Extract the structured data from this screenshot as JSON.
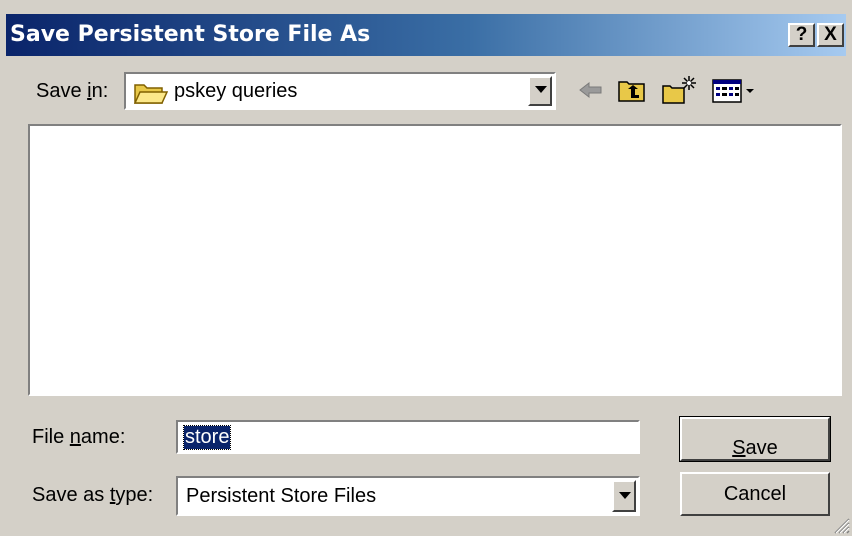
{
  "dialog": {
    "title": "Save Persistent Store File As",
    "help_label": "?",
    "close_label": "X"
  },
  "save_in": {
    "label_pre": "Save ",
    "label_key": "i",
    "label_post": "n:",
    "folder": "pskey queries",
    "folder_icon": "folder-icon"
  },
  "toolbar": {
    "icons": [
      "back-arrow-icon",
      "up-folder-icon",
      "new-folder-icon",
      "view-menu-icon"
    ]
  },
  "file_name": {
    "label_pre": "File ",
    "label_key": "n",
    "label_post": "ame:",
    "value": "store"
  },
  "save_type": {
    "label_pre": "Save as ",
    "label_key": "t",
    "label_post": "ype:",
    "value": "Persistent Store Files"
  },
  "buttons": {
    "save_key": "S",
    "save_rest": "ave",
    "cancel": "Cancel"
  },
  "colors": {
    "title_gradient_start": "#0a246a",
    "title_gradient_end": "#a6caf0",
    "face": "#d4d0c8",
    "selection": "#0a246a"
  }
}
